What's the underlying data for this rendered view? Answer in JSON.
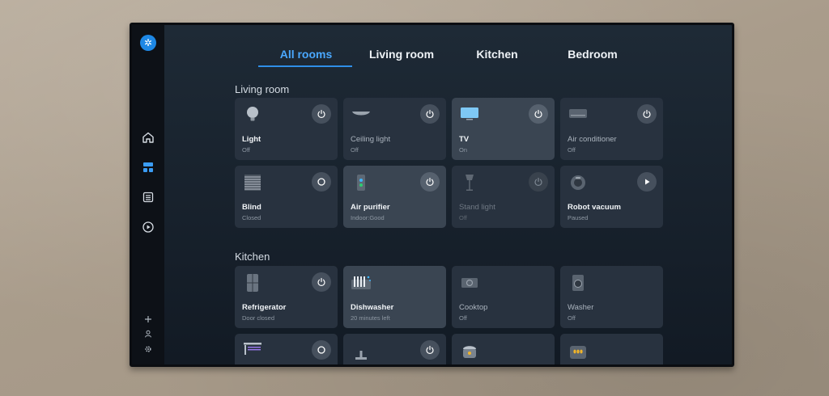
{
  "tabs": [
    {
      "label": "All rooms"
    },
    {
      "label": "Living room"
    },
    {
      "label": "Kitchen"
    },
    {
      "label": "Bedroom"
    }
  ],
  "sections": [
    {
      "title": "Living room",
      "devices": [
        {
          "name": "Light",
          "status": "Off",
          "icon": "bulb-icon",
          "control": "power"
        },
        {
          "name": "Ceiling light",
          "status": "Off",
          "icon": "ceiling-light-icon",
          "control": "power"
        },
        {
          "name": "TV",
          "status": "On",
          "icon": "tv-icon",
          "control": "power"
        },
        {
          "name": "Air conditioner",
          "status": "Off",
          "icon": "air-conditioner-icon",
          "control": "power"
        },
        {
          "name": "Blind",
          "status": "Closed",
          "icon": "blind-icon",
          "control": "circle"
        },
        {
          "name": "Air purifier",
          "status": "Indoor:Good",
          "icon": "air-purifier-icon",
          "control": "power"
        },
        {
          "name": "Stand light",
          "status": "Off",
          "icon": "stand-light-icon",
          "control": "power"
        },
        {
          "name": "Robot vacuum",
          "status": "Paused",
          "icon": "robot-vacuum-icon",
          "control": "play"
        }
      ]
    },
    {
      "title": "Kitchen",
      "devices": [
        {
          "name": "Refrigerator",
          "status": "Door closed",
          "icon": "refrigerator-icon",
          "control": "power"
        },
        {
          "name": "Dishwasher",
          "status": "20 minutes left",
          "icon": "dishwasher-icon",
          "control": ""
        },
        {
          "name": "Cooktop",
          "status": "Off",
          "icon": "cooktop-icon",
          "control": ""
        },
        {
          "name": "Washer",
          "status": "Off",
          "icon": "washer-icon",
          "control": ""
        },
        {
          "name": "",
          "status": "",
          "icon": "range-hood-icon",
          "control": "circle"
        },
        {
          "name": "",
          "status": "",
          "icon": "faucet-icon",
          "control": "power"
        },
        {
          "name": "",
          "status": "",
          "icon": "rice-cooker-icon",
          "control": ""
        },
        {
          "name": "",
          "status": "",
          "icon": "oven-icon",
          "control": ""
        }
      ]
    }
  ],
  "colors": {
    "accent": "#4aa8ff",
    "card": "#28323f",
    "card_on": "#3a4552"
  }
}
